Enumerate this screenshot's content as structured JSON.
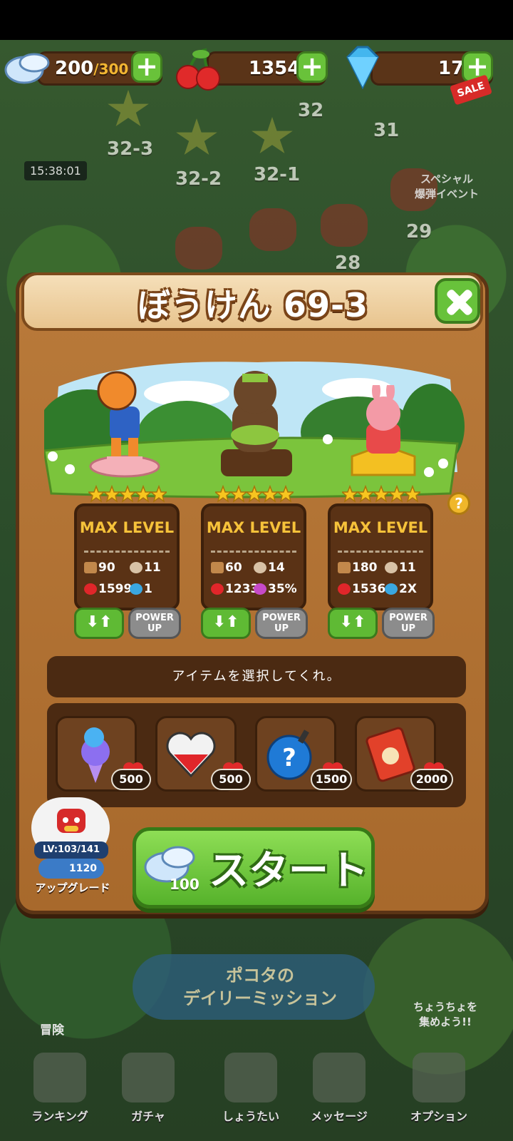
{
  "resources": {
    "wings": {
      "value": "200",
      "max": "/300"
    },
    "cherries": {
      "value": "1354"
    },
    "gems": {
      "value": "17",
      "badge": "SALE"
    }
  },
  "background": {
    "timer": "15:38:01",
    "nodes": [
      "32",
      "31",
      "32-3",
      "32-2",
      "32-1",
      "29",
      "28"
    ],
    "event_label": "スペシャル\n爆弾イベント",
    "mission_label": "ポコタの\nデイリーミッション",
    "adventure_label": "冒険",
    "butterfly_label": "ちょうちょを\n集めよう!!"
  },
  "nav": [
    {
      "label": "ランキング",
      "icon": "trophy-icon"
    },
    {
      "label": "ガチャ",
      "icon": "bunny-gacha-icon"
    },
    {
      "label": "しょうたい",
      "icon": "invite-bird-icon"
    },
    {
      "label": "メッセージ",
      "icon": "mail-icon"
    },
    {
      "label": "オプション",
      "icon": "gear-icon"
    }
  ],
  "dialog": {
    "title": "ぼうけん 69-3",
    "characters": [
      {
        "name_icon": "tiger-icon",
        "stars": 5,
        "level_label": "MAX LEVEL",
        "attack": "90",
        "skill_cost": "11",
        "hp": "1599",
        "bonus": "1",
        "swap": "⬇⬆",
        "power": "POWER\nUP"
      },
      {
        "name_icon": "bear-icon",
        "stars": 5,
        "level_label": "MAX LEVEL",
        "attack": "60",
        "skill_cost": "14",
        "hp": "1233",
        "bonus": "35%",
        "swap": "⬇⬆",
        "power": "POWER\nUP"
      },
      {
        "name_icon": "pig-bunny-icon",
        "stars": 5,
        "level_label": "MAX LEVEL",
        "attack": "180",
        "skill_cost": "11",
        "hp": "1536",
        "bonus": "2X",
        "swap": "⬇⬆",
        "power": "POWER\nUP"
      }
    ],
    "help": "?",
    "message": "アイテムを選択してくれ。",
    "items": [
      {
        "icon": "ice-cream-icon",
        "price": "500"
      },
      {
        "icon": "heart-potion-icon",
        "price": "500"
      },
      {
        "icon": "mystery-bomb-icon",
        "price": "1500"
      },
      {
        "icon": "spell-book-icon",
        "price": "2000"
      }
    ],
    "upgrade": {
      "level": "LV:103/141",
      "cost": "1120",
      "label": "アップグレード"
    },
    "start": {
      "label": "スタート",
      "cost": "100"
    }
  },
  "colors": {
    "panel": "#a8692c",
    "panel_dark": "#4b2a12",
    "green_button": "#5fba34",
    "gold_text": "#f6c23a"
  }
}
